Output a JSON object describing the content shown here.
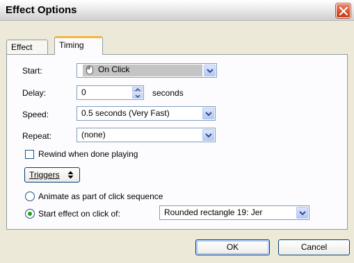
{
  "window": {
    "title": "Effect Options"
  },
  "tabs": [
    {
      "label": "Effect"
    },
    {
      "label": "Timing"
    }
  ],
  "timing": {
    "start": {
      "label": "Start:",
      "value": "On Click"
    },
    "delay": {
      "label": "Delay:",
      "value": "0",
      "unit": "seconds"
    },
    "speed": {
      "label": "Speed:",
      "value": "0.5 seconds (Very Fast)"
    },
    "repeat": {
      "label": "Repeat:",
      "value": "(none)"
    },
    "rewind": {
      "label": "Rewind when done playing",
      "checked": false
    },
    "triggers_button": "Triggers",
    "animate_option": {
      "label": "Animate as part of click sequence",
      "selected": false
    },
    "start_on_click": {
      "label": "Start effect on click of:",
      "selected": true,
      "value": "Rounded rectangle 19: Jer"
    }
  },
  "buttons": {
    "ok": "OK",
    "cancel": "Cancel"
  },
  "icons": {
    "close": "close-icon",
    "mouse": "mouse-icon",
    "dropdown": "chevron-down-icon",
    "spin": "spin-arrows-icon",
    "triggers": "up-down-icon"
  },
  "colors": {
    "close_button": "#d9512a",
    "active_tab_accent": "#f5b541",
    "radio_dot": "#21a121"
  }
}
